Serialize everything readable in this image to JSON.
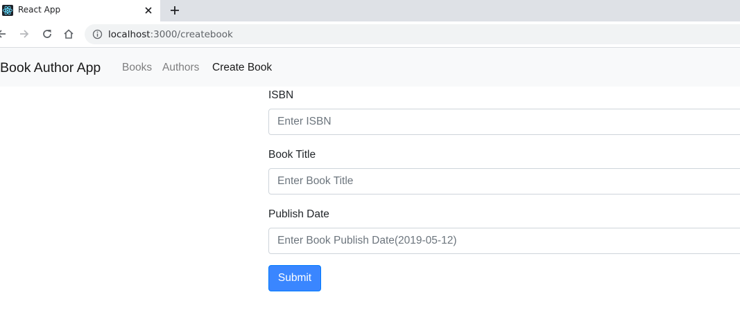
{
  "browser": {
    "tab_title": "React App",
    "favicon_icon": "react-icon",
    "url_host": "localhost",
    "url_path": ":3000/createbook"
  },
  "navbar": {
    "brand": "Book Author App",
    "links": [
      {
        "label": "Books",
        "active": false
      },
      {
        "label": "Authors",
        "active": false
      },
      {
        "label": "Create Book",
        "active": true
      }
    ]
  },
  "form": {
    "fields": [
      {
        "label": "ISBN",
        "placeholder": "Enter ISBN",
        "value": ""
      },
      {
        "label": "Book Title",
        "placeholder": "Enter Book Title",
        "value": ""
      },
      {
        "label": "Publish Date",
        "placeholder": "Enter Book Publish Date(2019-05-12)",
        "value": ""
      }
    ],
    "submit_label": "Submit"
  },
  "colors": {
    "primary": "#3a86ff",
    "navbar_bg": "#f8f9fa",
    "tabstrip_bg": "#dee1e6"
  }
}
